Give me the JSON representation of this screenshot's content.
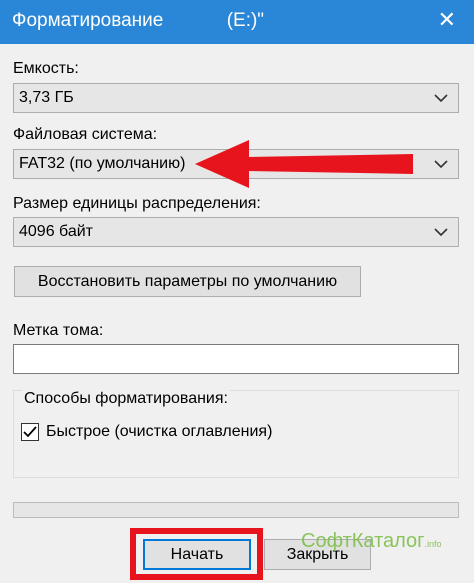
{
  "window": {
    "title": "Форматирование            (E:)\"",
    "close_icon": "close-icon"
  },
  "capacity": {
    "label": "Емкость:",
    "value": "3,73 ГБ"
  },
  "filesystem": {
    "label": "Файловая система:",
    "value": "FAT32 (по умолчанию)"
  },
  "allocation": {
    "label": "Размер единицы распределения:",
    "value": "4096 байт"
  },
  "restore_defaults_label": "Восстановить параметры по умолчанию",
  "volume_label": {
    "label": "Метка тома:",
    "value": ""
  },
  "format_options": {
    "label": "Способы форматирования:",
    "quick_format_label": "Быстрое (очистка оглавления)",
    "quick_format_checked": true
  },
  "progress": {
    "value": 0
  },
  "buttons": {
    "start_label": "Начать",
    "close_label": "Закрыть"
  },
  "watermark": {
    "text": "СофтКаталог",
    "suffix": ".info"
  },
  "colors": {
    "titlebar": "#2a86d6",
    "annotation_red": "#e8141d",
    "watermark_green": "#7fbf4a"
  }
}
